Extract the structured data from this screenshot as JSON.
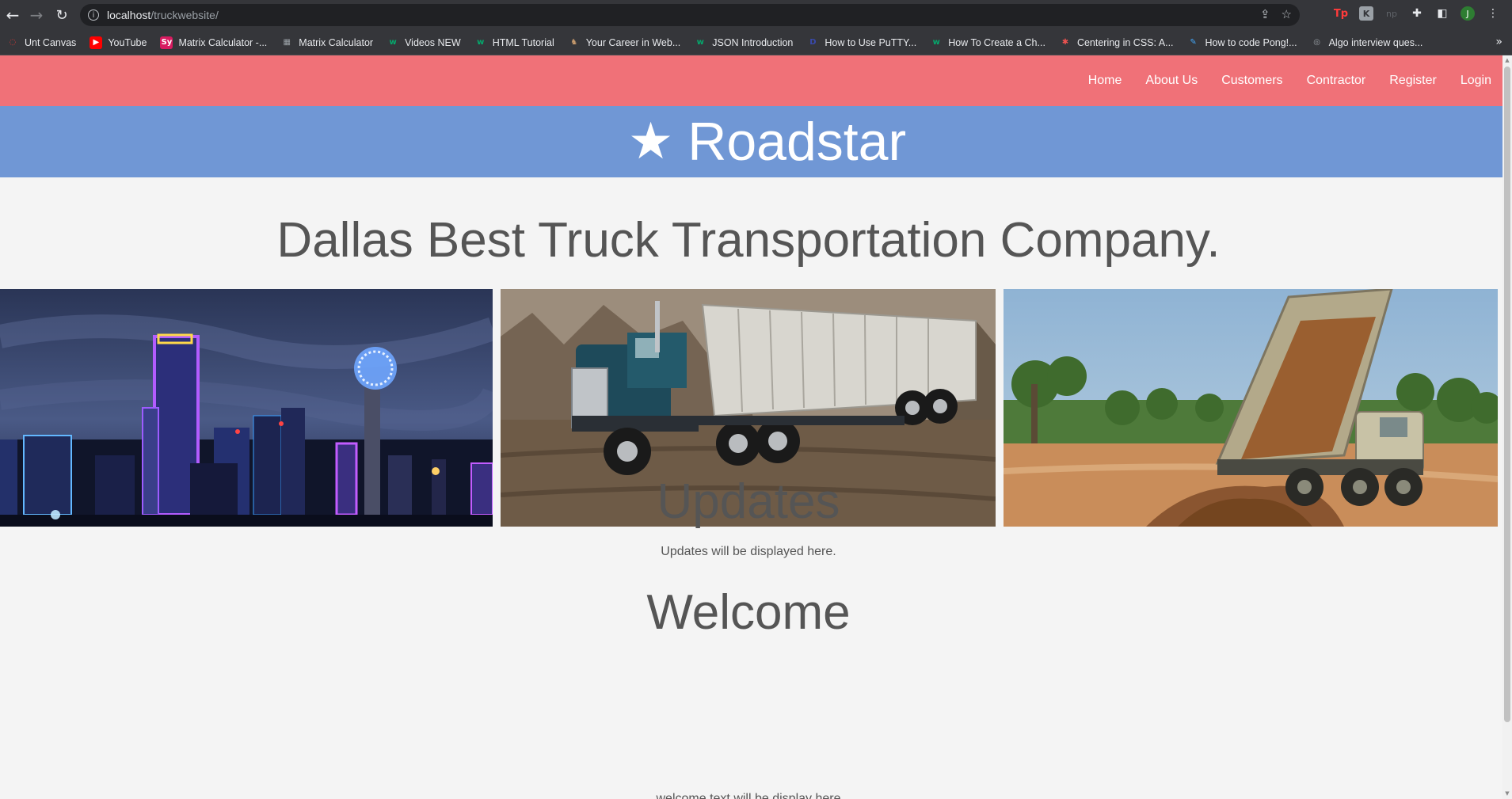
{
  "browser": {
    "url_host": "localhost",
    "url_path": "/truckwebsite/",
    "bookmarks": [
      {
        "label": "Unt Canvas",
        "icon": "canvas-icon",
        "color": "#e53935"
      },
      {
        "label": "YouTube",
        "icon": "youtube-icon",
        "color": "#ff0000"
      },
      {
        "label": "Matrix Calculator -...",
        "icon": "symbolab-icon",
        "color": "#d81b60"
      },
      {
        "label": "Matrix Calculator",
        "icon": "calculator-icon",
        "color": "#9aa0a6"
      },
      {
        "label": "Videos NEW",
        "icon": "w3schools-icon",
        "color": "#04aa6d"
      },
      {
        "label": "HTML Tutorial",
        "icon": "w3schools-icon",
        "color": "#04aa6d"
      },
      {
        "label": "Your Career in Web...",
        "icon": "owl-icon",
        "color": "#c69a6d"
      },
      {
        "label": "JSON Introduction",
        "icon": "w3schools-icon",
        "color": "#04aa6d"
      },
      {
        "label": "How to Use PuTTY...",
        "icon": "d-icon",
        "color": "#3949ab"
      },
      {
        "label": "How To Create a Ch...",
        "icon": "w3schools-icon",
        "color": "#04aa6d"
      },
      {
        "label": "Centering in CSS: A...",
        "icon": "asterisk-icon",
        "color": "#ef5350"
      },
      {
        "label": "How to code Pong!...",
        "icon": "pen-icon",
        "color": "#42a5f5"
      },
      {
        "label": "Algo interview ques...",
        "icon": "algo-icon",
        "color": "#9aa0a6"
      }
    ]
  },
  "site": {
    "nav": [
      "Home",
      "About Us",
      "Customers",
      "Contractor",
      "Register",
      "Login"
    ],
    "brand_star": "★",
    "brand_name": "Roadstar",
    "headline": "Dallas Best Truck Transportation Company.",
    "updates_title": "Updates",
    "updates_text": "Updates will be displayed here.",
    "welcome_title": "Welcome",
    "welcome_text": "welcome text will be display here"
  },
  "colors": {
    "nav_bg": "#f07178",
    "brand_bg": "#7097d5",
    "page_bg": "#f4f4f4",
    "heading_text": "#555555"
  }
}
